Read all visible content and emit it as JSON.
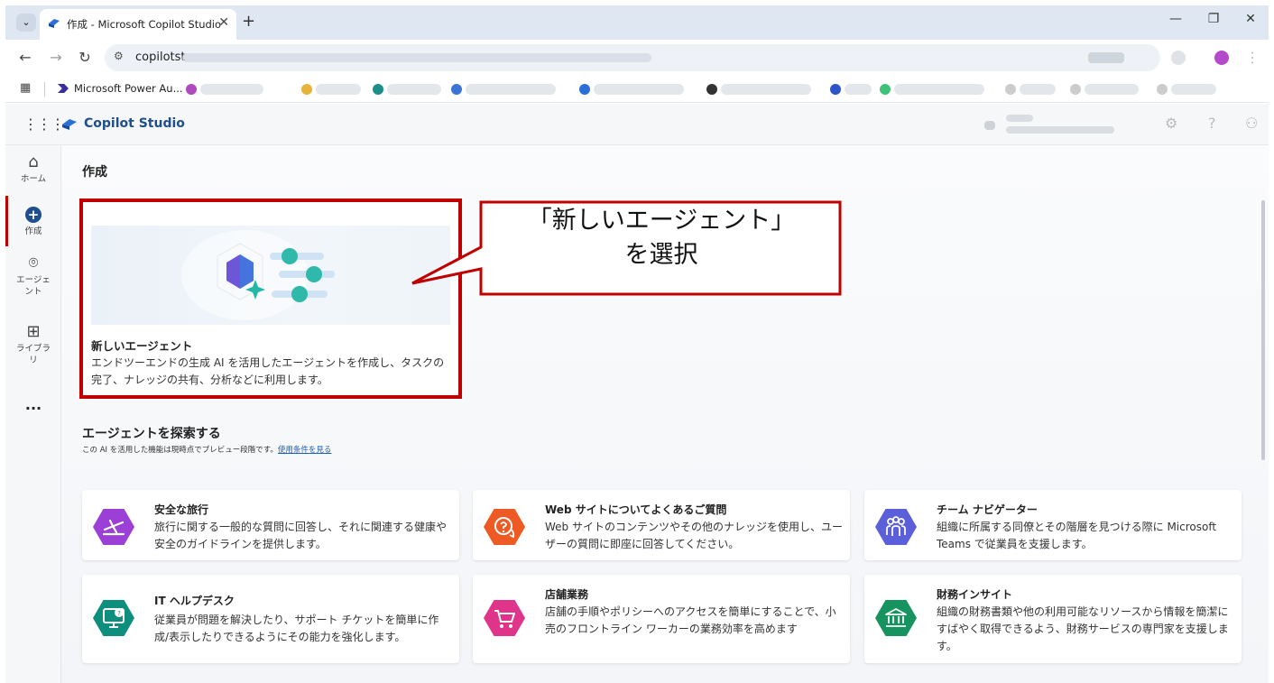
{
  "browser": {
    "tab_title": "作成 - Microsoft Copilot Studio",
    "url_prefix": "copilotst",
    "bookmark_first": "Microsoft Power Au..."
  },
  "app": {
    "name": "Copilot Studio"
  },
  "rail": {
    "home": "ホーム",
    "create": "作成",
    "agents": "エージェ\nント",
    "library": "ライブラ\nリ",
    "more": "..."
  },
  "page": {
    "title": "作成",
    "new_agent": {
      "title": "新しいエージェント",
      "desc": "エンドツーエンドの生成 AI を活用したエージェントを作成し、タスクの完了、ナレッジの共有、分析などに利用します。"
    },
    "callout": {
      "line1": "「新しいエージェント」",
      "line2": "を選択"
    },
    "explore": {
      "title": "エージェントを探索する",
      "sub": "この AI を活用した機能は現時点でプレビュー段階です。",
      "link": "使用条件を見る"
    },
    "cards": [
      {
        "title": "安全な旅行",
        "desc": "旅行に関する一般的な質問に回答し、それに関連する健康や安全のガイドラインを提供します。",
        "icon": "airplane-icon",
        "color": "#9b3fd6"
      },
      {
        "title": "Web サイトについてよくあるご質問",
        "desc": "Web サイトのコンテンツやその他のナレッジを使用し、ユーザーの質問に即座に回答してください。",
        "icon": "question-chat-icon",
        "color": "#ee5a24"
      },
      {
        "title": "チーム ナビゲーター",
        "desc": "組織に所属する同僚とその階層を見つける際に Microsoft Teams で従業員を支援します。",
        "icon": "people-icon",
        "color": "#5b5fd9"
      },
      {
        "title": "IT ヘルプデスク",
        "desc": "従業員が問題を解決したり、サポート チケットを簡単に作成/表示したりできるようにその能力を強化します。",
        "icon": "monitor-help-icon",
        "color": "#0e8f7e"
      },
      {
        "title": "店舗業務",
        "desc": "店舗の手順やポリシーへのアクセスを簡単にすることで、小売のフロントライン ワーカーの業務効率を高めます",
        "icon": "shopping-cart-icon",
        "color": "#e0348a"
      },
      {
        "title": "財務インサイト",
        "desc": "組織の財務書類や他の利用可能なリソースから情報を簡潔にすばやく取得できるよう、財務サービスの専門家を支援します。",
        "icon": "bank-icon",
        "color": "#16935f"
      }
    ]
  }
}
